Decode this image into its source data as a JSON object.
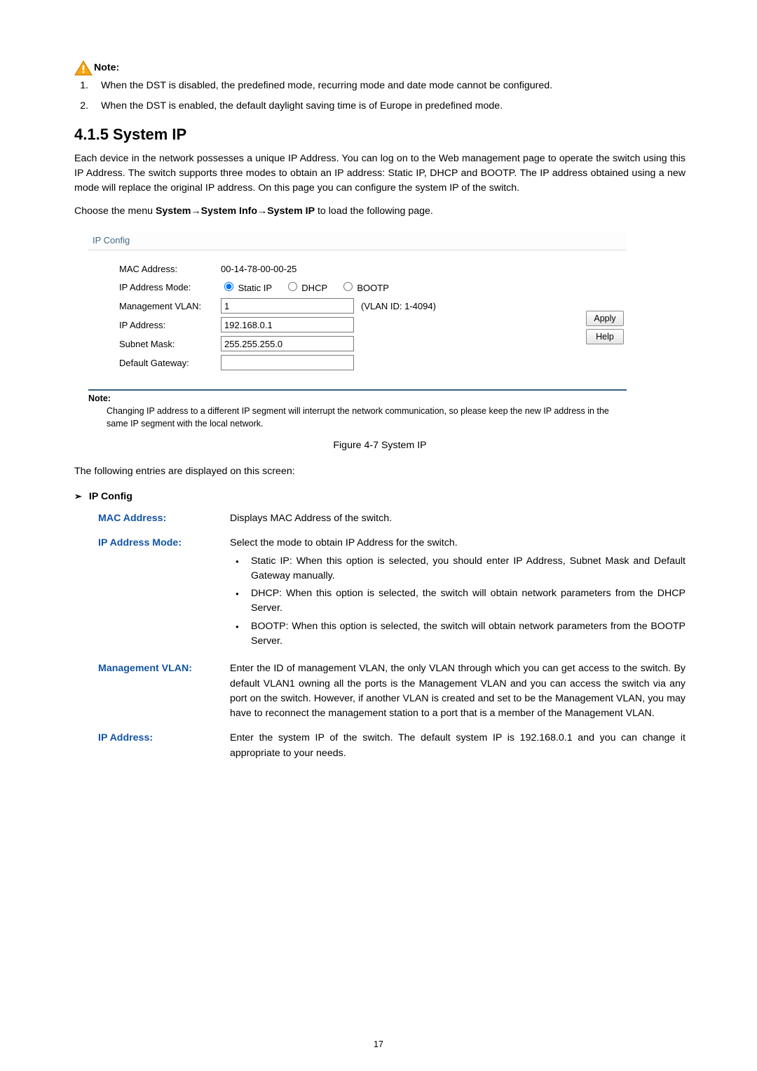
{
  "note": {
    "label": "Note:",
    "items": [
      "When the DST is disabled, the predefined mode, recurring mode and date mode cannot be configured.",
      "When the DST is enabled, the default daylight saving time is of Europe in predefined mode."
    ]
  },
  "section": {
    "heading": "4.1.5 System IP",
    "intro": "Each device in the network possesses a unique IP Address. You can log on to the Web management page to operate the switch using this IP Address. The switch supports three modes to obtain an IP address: Static IP, DHCP and BOOTP. The IP address obtained using a new mode will replace the original IP address. On this page you can configure the system IP of the switch.",
    "menu_prefix": "Choose the menu ",
    "menu_bold": "System→System Info→System IP",
    "menu_suffix": " to load the following page."
  },
  "shot": {
    "panel_title": "IP Config",
    "rows": {
      "mac_label": "MAC Address:",
      "mac_value": "00-14-78-00-00-25",
      "mode_label": "IP Address Mode:",
      "mode_opts": {
        "static": "Static IP",
        "dhcp": "DHCP",
        "bootp": "BOOTP"
      },
      "vlan_label": "Management VLAN:",
      "vlan_value": "1",
      "vlan_hint": "(VLAN ID: 1-4094)",
      "ip_label": "IP Address:",
      "ip_value": "192.168.0.1",
      "mask_label": "Subnet Mask:",
      "mask_value": "255.255.255.0",
      "gw_label": "Default Gateway:",
      "gw_value": ""
    },
    "buttons": {
      "apply": "Apply",
      "help": "Help"
    },
    "note_label": "Note:",
    "note_text": "Changing IP address to a different IP segment will interrupt the network communication, so please keep the new IP address in the same IP segment with the local network.",
    "caption": "Figure 4-7 System IP"
  },
  "defs": {
    "intro": "The following entries are displayed on this screen:",
    "group_label": "IP Config",
    "mac": {
      "term": "MAC Address:",
      "body": "Displays MAC Address of the switch."
    },
    "mode": {
      "term": "IP Address Mode:",
      "body": "Select the mode to obtain IP Address for the switch.",
      "items": [
        "Static IP: When this option is selected, you should enter IP Address, Subnet Mask and Default Gateway manually.",
        "DHCP: When this option is selected, the switch will obtain network parameters from the DHCP Server.",
        "BOOTP: When this option is selected, the switch will obtain network parameters from the BOOTP Server."
      ]
    },
    "vlan": {
      "term": "Management VLAN:",
      "body": "Enter the ID of management VLAN, the only VLAN through which you can get access to the switch. By default VLAN1 owning all the ports is the Management VLAN and you can access the switch via any port on the switch. However, if another VLAN is created and set to be the Management VLAN, you may have to reconnect the management station to a port that is a member of the Management VLAN."
    },
    "ip": {
      "term": "IP Address:",
      "body": "Enter the system IP of the switch. The default system IP is 192.168.0.1 and you can change it appropriate to your needs."
    }
  },
  "page_number": "17"
}
